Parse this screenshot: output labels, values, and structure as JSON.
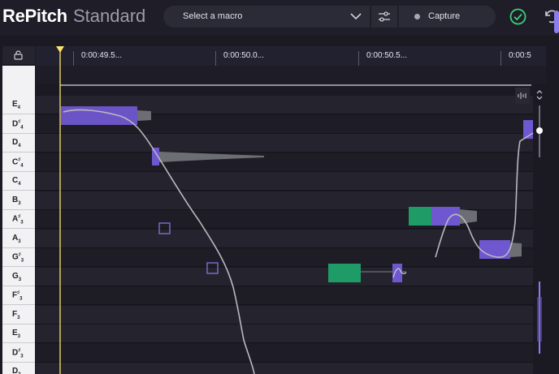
{
  "app": {
    "name_bold": "RePitch",
    "name_light": "Standard"
  },
  "toolbar": {
    "macro_placeholder": "Select a macro",
    "capture_label": "Capture",
    "icons": [
      "chevron-down-icon",
      "sliders-icon",
      "record-dot-icon",
      "checkmark-circle-icon",
      "undo-icon"
    ]
  },
  "timeline": {
    "markers": [
      "0:00:49.5...",
      "0:00:50.0...",
      "0:00:50.5...",
      "0:00:5"
    ]
  },
  "pitch_labels": [
    {
      "note": "E",
      "oct": "4",
      "sharp": false
    },
    {
      "note": "D",
      "oct": "4",
      "sharp": true
    },
    {
      "note": "D",
      "oct": "4",
      "sharp": false
    },
    {
      "note": "C",
      "oct": "4",
      "sharp": true
    },
    {
      "note": "C",
      "oct": "4",
      "sharp": false
    },
    {
      "note": "B",
      "oct": "3",
      "sharp": false
    },
    {
      "note": "A",
      "oct": "3",
      "sharp": true
    },
    {
      "note": "A",
      "oct": "3",
      "sharp": false
    },
    {
      "note": "G",
      "oct": "3",
      "sharp": true
    },
    {
      "note": "G",
      "oct": "3",
      "sharp": false
    },
    {
      "note": "F",
      "oct": "3",
      "sharp": true
    },
    {
      "note": "F",
      "oct": "3",
      "sharp": false
    },
    {
      "note": "E",
      "oct": "3",
      "sharp": false
    },
    {
      "note": "D",
      "oct": "3",
      "sharp": true
    },
    {
      "note": "D",
      "oct": "3",
      "sharp": false
    }
  ],
  "colors": {
    "note_purple": "#6f57cf",
    "note_green": "#1f9b67",
    "playhead": "#ffe36a",
    "pitch_curve": "#b9b9c0",
    "accent_check": "#3bd17c"
  }
}
